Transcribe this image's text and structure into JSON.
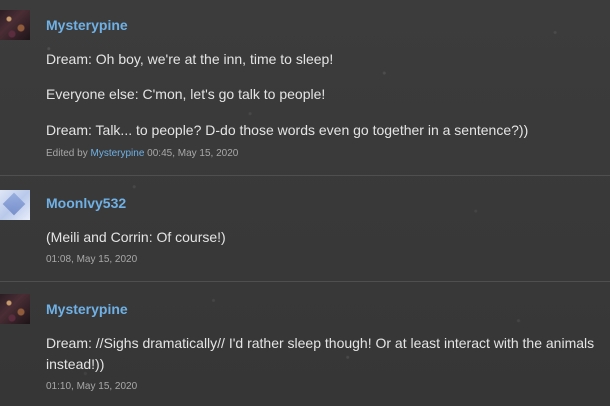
{
  "posts": [
    {
      "username": "Mysterypine",
      "lines": [
        "Dream: Oh boy, we're at the inn, time to sleep!",
        "Everyone else: C'mon, let's go talk to people!",
        "Dream: Talk... to people? D-do those words even go together in a sentence?))"
      ],
      "edited_prefix": "Edited by",
      "edited_by": "Mysterypine",
      "timestamp": "00:45, May 15, 2020"
    },
    {
      "username": "Moonlvy532",
      "lines": [
        "(Meili and Corrin: Of course!)"
      ],
      "timestamp": "01:08, May 15, 2020"
    },
    {
      "username": "Mysterypine",
      "lines": [
        "Dream: //Sighs dramatically// I'd rather sleep though! Or at least interact with the animals",
        "instead!))"
      ],
      "timestamp": "01:10, May 15, 2020"
    }
  ]
}
